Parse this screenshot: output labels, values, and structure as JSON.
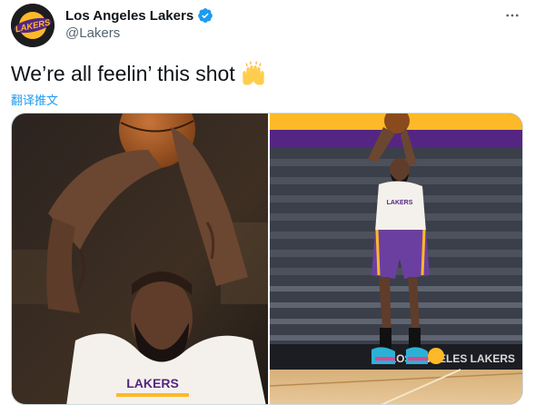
{
  "account": {
    "display_name": "Los Angeles Lakers",
    "handle": "@Lakers",
    "verified": true,
    "avatar_text": "LAKERS"
  },
  "tweet": {
    "text": "We’re all feelin’ this shot",
    "emoji": "raising-hands",
    "translate_label": "翻译推文"
  },
  "media": {
    "count": 2,
    "right_photo_court_signage": "LOS ANGELES LAKERS"
  },
  "colors": {
    "link_blue": "#1d9bf0",
    "handle_gray": "#536471",
    "lakers_purple": "#552583",
    "lakers_gold": "#fdb927",
    "verified_blue": "#1d9bf0"
  }
}
